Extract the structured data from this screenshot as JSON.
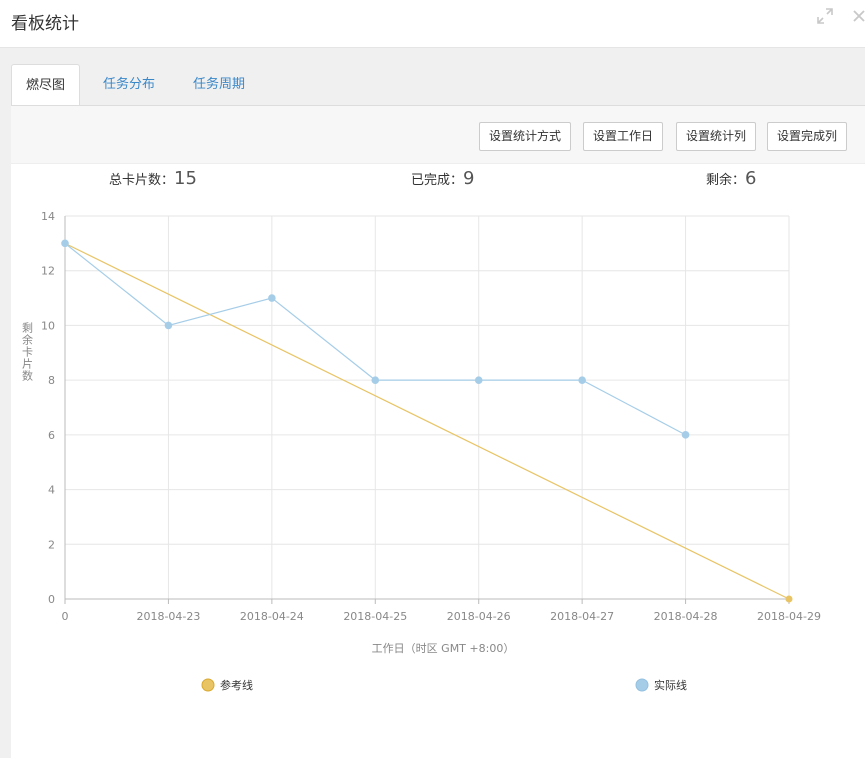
{
  "window": {
    "title": "看板统计",
    "icons": [
      "expand-icon",
      "close-icon"
    ]
  },
  "tabs": [
    {
      "label": "燃尽图",
      "active": true
    },
    {
      "label": "任务分布",
      "active": false
    },
    {
      "label": "任务周期",
      "active": false
    }
  ],
  "toolbar": {
    "stat_method": "设置统计方式",
    "workdays": "设置工作日",
    "stat_columns": "设置统计列",
    "done_columns": "设置完成列"
  },
  "summary": {
    "total_label": "总卡片数：",
    "total_value": "15",
    "done_label": "已完成：",
    "done_value": "9",
    "remain_label": "剩余：",
    "remain_value": "6"
  },
  "colors": {
    "reference": "#e8c465",
    "actual": "#a6cde8",
    "grid": "#e6e6e6",
    "axis": "#bbbbbb"
  },
  "chart_data": {
    "type": "line",
    "categories": [
      "0",
      "2018-04-23",
      "2018-04-24",
      "2018-04-25",
      "2018-04-26",
      "2018-04-27",
      "2018-04-28",
      "2018-04-29"
    ],
    "series": [
      {
        "name": "参考线",
        "values": [
          13,
          null,
          null,
          null,
          null,
          null,
          null,
          0
        ]
      },
      {
        "name": "实际线",
        "values": [
          13,
          10,
          11,
          8,
          8,
          8,
          6,
          null
        ]
      }
    ],
    "xlabel": "工作日（时区 GMT +8:00）",
    "ylabel": "剩余卡片数",
    "ylim": [
      0,
      14
    ],
    "yticks": [
      0,
      2,
      4,
      6,
      8,
      10,
      12,
      14
    ],
    "grid": true,
    "legend": "bottom"
  }
}
